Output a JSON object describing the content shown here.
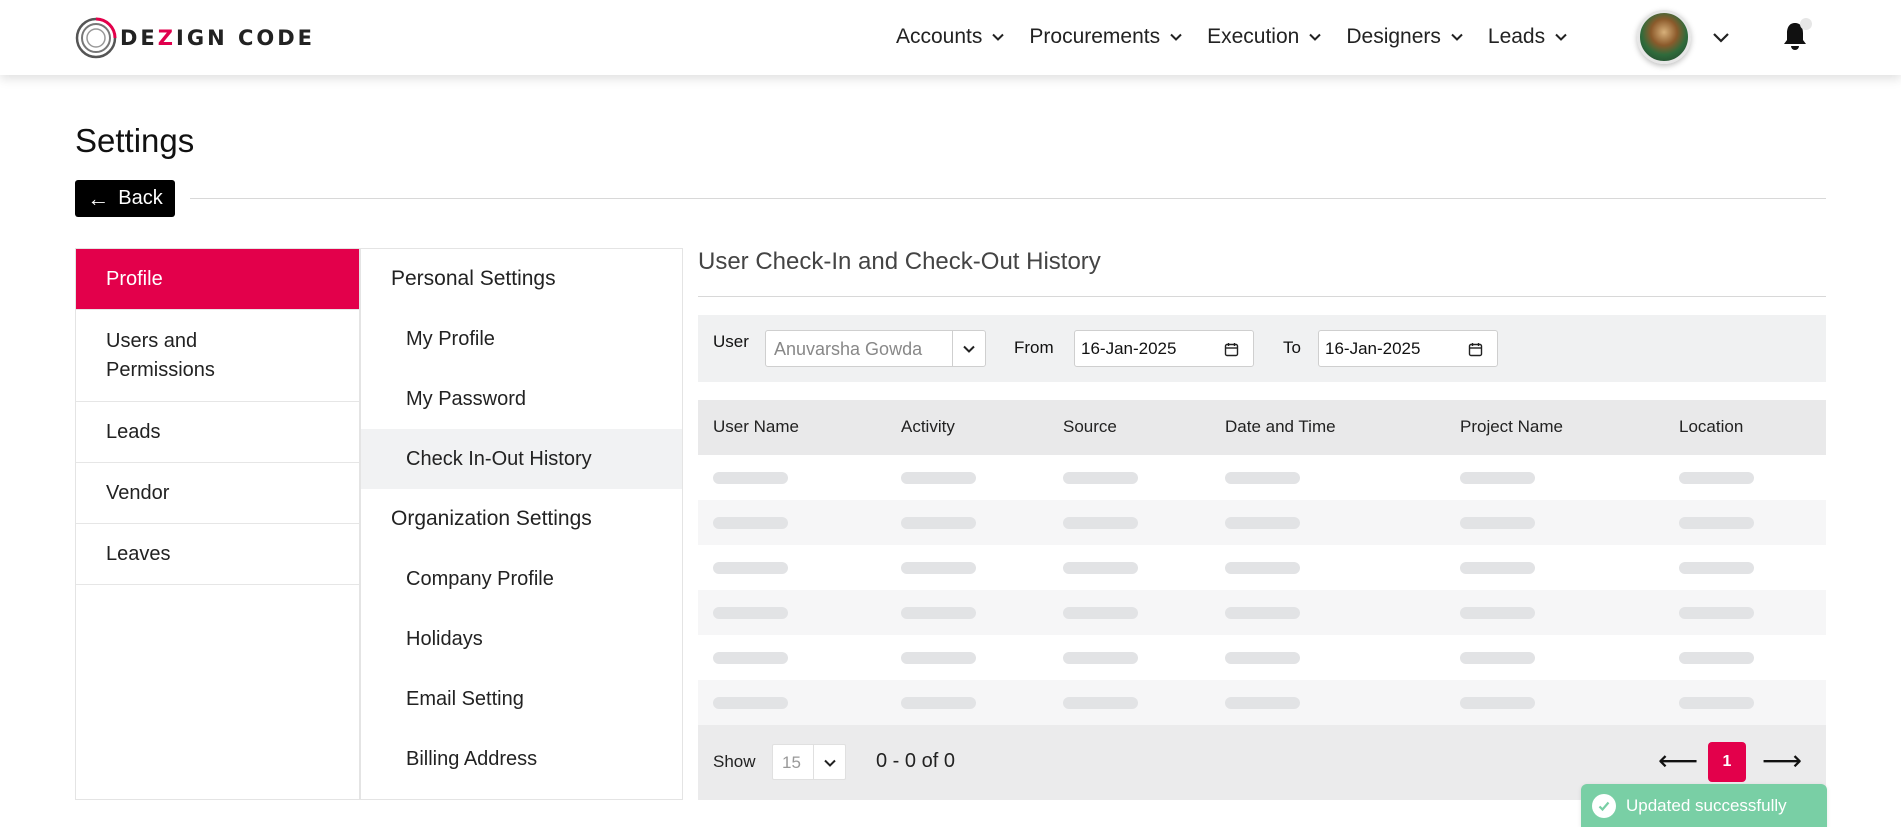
{
  "brand": {
    "name_part1": "DE",
    "name_z": "Z",
    "name_part2": "IGN CODE",
    "accent_color": "#e3004b"
  },
  "nav": {
    "items": [
      {
        "label": "Accounts"
      },
      {
        "label": "Procurements"
      },
      {
        "label": "Execution"
      },
      {
        "label": "Designers"
      },
      {
        "label": "Leads"
      }
    ]
  },
  "header": {
    "title": "Settings",
    "back_label": "Back"
  },
  "left_menu": {
    "items": [
      {
        "label": "Profile"
      },
      {
        "label": "Users and Permissions"
      },
      {
        "label": "Leads"
      },
      {
        "label": "Vendor"
      },
      {
        "label": "Leaves"
      }
    ]
  },
  "mid_menu": {
    "personal_heading": "Personal Settings",
    "personal_items": [
      {
        "label": "My Profile"
      },
      {
        "label": "My Password"
      },
      {
        "label": "Check In-Out History"
      }
    ],
    "org_heading": "Organization Settings",
    "org_items": [
      {
        "label": "Company Profile"
      },
      {
        "label": "Holidays"
      },
      {
        "label": "Email Setting"
      },
      {
        "label": "Billing Address"
      }
    ]
  },
  "content": {
    "title": "User Check-In and Check-Out History",
    "filters": {
      "user_label": "User",
      "user_value": "Anuvarsha Gowda",
      "from_label": "From",
      "from_value": "16-Jan-2025",
      "to_label": "To",
      "to_value": "16-Jan-2025"
    },
    "table": {
      "columns": [
        "User Name",
        "Activity",
        "Source",
        "Date and Time",
        "Project Name",
        "Location"
      ]
    },
    "footer": {
      "show_label": "Show",
      "page_size": "15",
      "range": "0 - 0 of 0",
      "current_page": "1",
      "prev_glyph": "⟵",
      "next_glyph": "⟶"
    }
  },
  "toast": {
    "message": "Updated successfully",
    "color": "#79cfa5"
  }
}
